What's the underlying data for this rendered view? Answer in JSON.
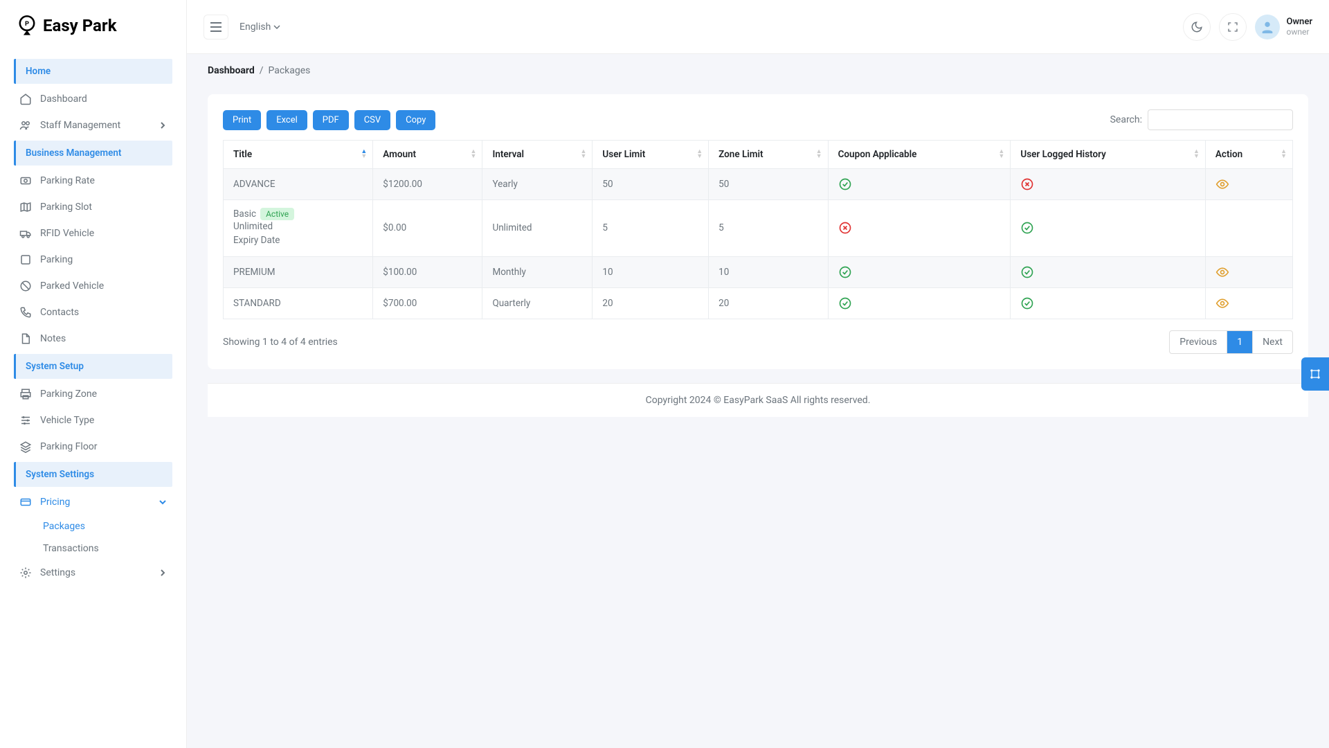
{
  "brand": "Easy Park",
  "topbar": {
    "lang": "English",
    "user_name": "Owner",
    "user_role": "owner"
  },
  "breadcrumb": {
    "root": "Dashboard",
    "current": "Packages"
  },
  "sidebar": {
    "sections": [
      {
        "label": "Home",
        "items": [
          {
            "label": "Dashboard",
            "icon": "home"
          },
          {
            "label": "Staff Management",
            "icon": "users",
            "chevron": true
          }
        ]
      },
      {
        "label": "Business Management",
        "items": [
          {
            "label": "Parking Rate",
            "icon": "dollar"
          },
          {
            "label": "Parking Slot",
            "icon": "map"
          },
          {
            "label": "RFID Vehicle",
            "icon": "truck"
          },
          {
            "label": "Parking",
            "icon": "square"
          },
          {
            "label": "Parked Vehicle",
            "icon": "ban"
          },
          {
            "label": "Contacts",
            "icon": "phone"
          },
          {
            "label": "Notes",
            "icon": "file"
          }
        ]
      },
      {
        "label": "System Setup",
        "items": [
          {
            "label": "Parking Zone",
            "icon": "print"
          },
          {
            "label": "Vehicle Type",
            "icon": "sliders"
          },
          {
            "label": "Parking Floor",
            "icon": "layers"
          }
        ]
      },
      {
        "label": "System Settings",
        "items": [
          {
            "label": "Pricing",
            "icon": "card",
            "active": true,
            "chevron": true,
            "open": true,
            "sub": [
              {
                "label": "Packages",
                "active": true
              },
              {
                "label": "Transactions"
              }
            ]
          },
          {
            "label": "Settings",
            "icon": "gear",
            "chevron": true
          }
        ]
      }
    ]
  },
  "toolbar": {
    "buttons": [
      "Print",
      "Excel",
      "PDF",
      "CSV",
      "Copy"
    ],
    "search_label": "Search:"
  },
  "table": {
    "columns": [
      "Title",
      "Amount",
      "Interval",
      "User Limit",
      "Zone Limit",
      "Coupon Applicable",
      "User Logged History",
      "Action"
    ],
    "rows": [
      {
        "title": "ADVANCE",
        "amount": "$1200.00",
        "interval": "Yearly",
        "user_limit": "50",
        "zone_limit": "50",
        "coupon": true,
        "history": false,
        "action": true
      },
      {
        "title": "Basic",
        "badge": "Active",
        "title_sub1": "Unlimited",
        "title_sub2": "Expiry Date",
        "amount": "$0.00",
        "interval": "Unlimited",
        "user_limit": "5",
        "zone_limit": "5",
        "coupon": false,
        "history": true,
        "action": false
      },
      {
        "title": "PREMIUM",
        "amount": "$100.00",
        "interval": "Monthly",
        "user_limit": "10",
        "zone_limit": "10",
        "coupon": true,
        "history": true,
        "action": true
      },
      {
        "title": "STANDARD",
        "amount": "$700.00",
        "interval": "Quarterly",
        "user_limit": "20",
        "zone_limit": "20",
        "coupon": true,
        "history": true,
        "action": true
      }
    ],
    "info": "Showing 1 to 4 of 4 entries",
    "pager": {
      "prev": "Previous",
      "pages": [
        "1"
      ],
      "next": "Next"
    }
  },
  "footer": "Copyright 2024 © EasyPark SaaS All rights reserved."
}
